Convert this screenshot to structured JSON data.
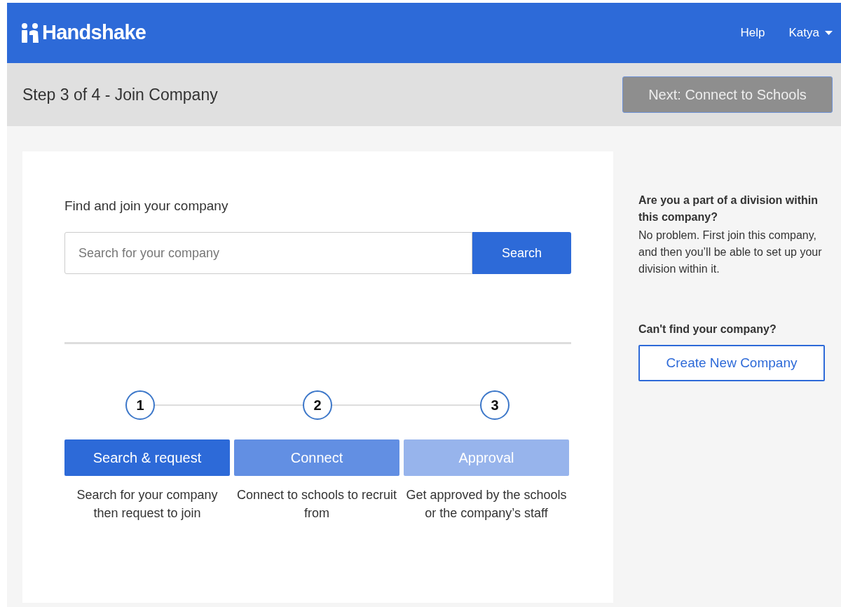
{
  "header": {
    "logo": "Handshake",
    "links": [
      {
        "label": "Help",
        "kind": "link"
      },
      {
        "label": "Katya",
        "kind": "menu"
      }
    ]
  },
  "subheader": {
    "title": "Step 3 of 4 - Join Company",
    "next_button": {
      "label": "Next: Connect to Schools",
      "disabled": true
    }
  },
  "main": {
    "heading": "Find and join your company",
    "search": {
      "placeholder": "Search for your company",
      "button": "Search"
    },
    "steps": [
      {
        "number": "1",
        "label": "Search & request",
        "color": "#2d6ad8",
        "description": "Search for your company then request to join"
      },
      {
        "number": "2",
        "label": "Connect",
        "color": "#628fe3",
        "description": "Connect to schools to recruit from"
      },
      {
        "number": "3",
        "label": "Approval",
        "color": "#97b4ec",
        "description": "Get approved by the schools or the company’s staff"
      }
    ]
  },
  "sidebar": {
    "division_title": "Are you a part of a division within this company?",
    "division_text": "No problem. First join this company, and then you’ll be able to set up your division within it.",
    "cant_find": "Can't find your company?",
    "create_button": "Create New Company"
  }
}
